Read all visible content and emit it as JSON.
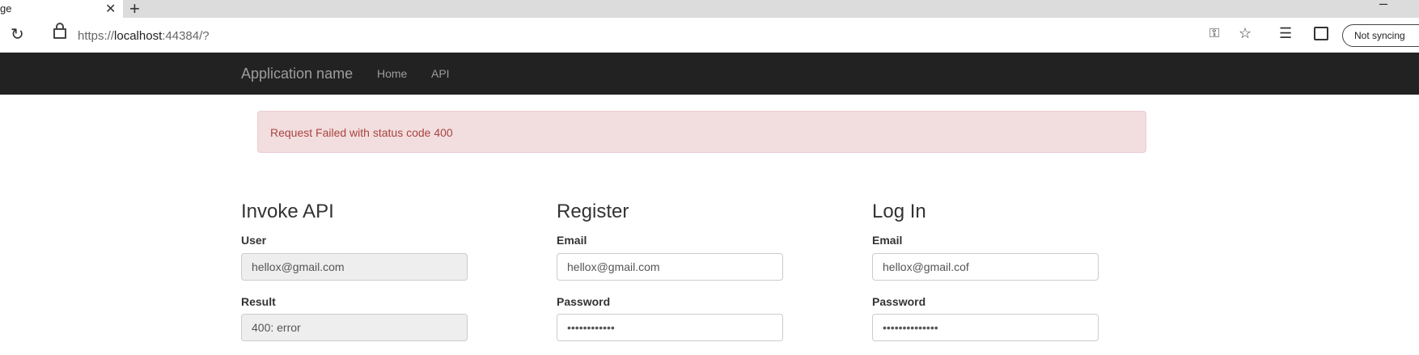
{
  "browser": {
    "tab_title": "ge",
    "tab_close": "✕",
    "new_tab": "+",
    "minimize": "–",
    "url_prefix": "https://",
    "url_host": "localhost",
    "url_suffix": ":44384/?",
    "sync_label": "Not syncing",
    "icons": [
      "reload-icon",
      "lock-icon",
      "key-icon",
      "star-icon",
      "favorites-icon",
      "collections-icon"
    ]
  },
  "navbar": {
    "brand": "Application name",
    "links": [
      "Home",
      "API"
    ]
  },
  "alert": {
    "message": "Request Failed with status code 400",
    "color": "#a94442",
    "background": "#f2dede"
  },
  "invoke_api": {
    "title": "Invoke API",
    "user_label": "User",
    "user_value": "hellox@gmail.com",
    "result_label": "Result",
    "result_value": "400: error"
  },
  "register": {
    "title": "Register",
    "email_label": "Email",
    "email_value": "hellox@gmail.com",
    "password_label": "Password",
    "password_value": "••••••••••••"
  },
  "login": {
    "title": "Log In",
    "email_label": "Email",
    "email_value": "hellox@gmail.cof",
    "password_label": "Password",
    "password_value": "••••••••••••••"
  }
}
